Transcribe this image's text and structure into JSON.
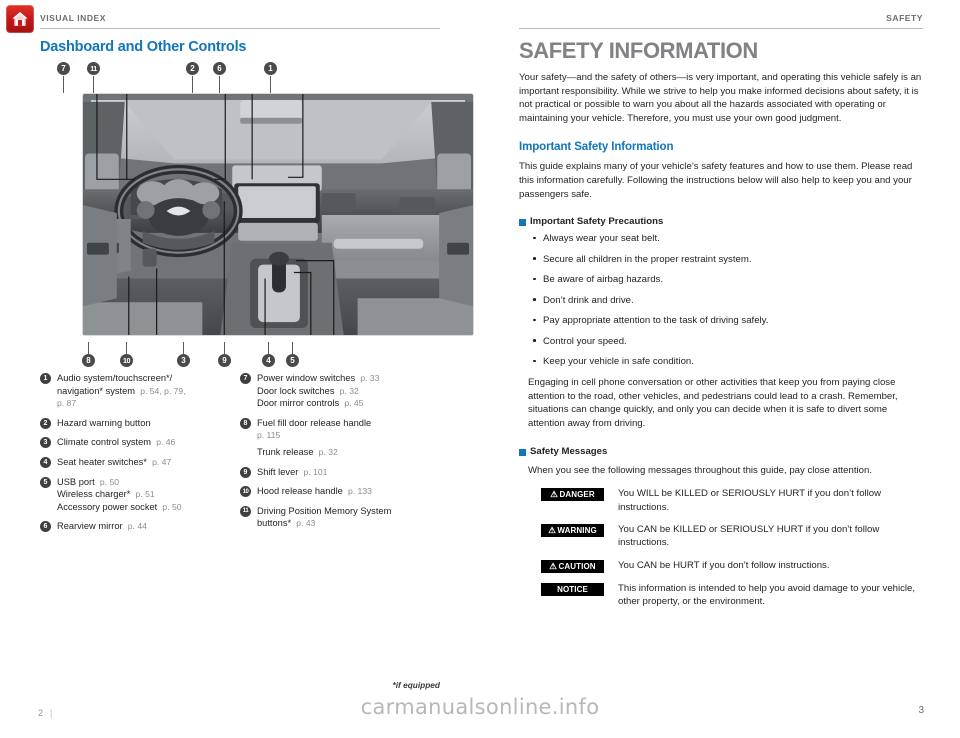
{
  "home_icon": "home-icon",
  "left_page": {
    "running_head": "VISUAL INDEX",
    "section_title": "Dashboard and Other Controls",
    "photo_alt": "dashboard-photo",
    "callouts_top": [
      "7",
      "11",
      "2",
      "6",
      "1"
    ],
    "callouts_bottom": [
      "8",
      "10",
      "3",
      "9",
      "4",
      "5"
    ],
    "legend_left": [
      {
        "num": "1",
        "lines": [
          {
            "text": "Audio system/touchscreen*/",
            "page": ""
          },
          {
            "text": "navigation* system",
            "page": "p. 54, p. 79,"
          },
          {
            "text": "",
            "page": "p. 87"
          }
        ]
      },
      {
        "num": "2",
        "lines": [
          {
            "text": "Hazard warning button",
            "page": ""
          }
        ]
      },
      {
        "num": "3",
        "lines": [
          {
            "text": "Climate control system",
            "page": "p. 46"
          }
        ]
      },
      {
        "num": "4",
        "lines": [
          {
            "text": "Seat heater switches*",
            "page": "p. 47"
          }
        ]
      },
      {
        "num": "5",
        "lines": [
          {
            "text": "USB port",
            "page": "p. 50"
          },
          {
            "text": "Wireless charger*",
            "page": "p. 51"
          },
          {
            "text": "Accessory power socket",
            "page": "p. 50"
          }
        ]
      },
      {
        "num": "6",
        "lines": [
          {
            "text": "Rearview mirror",
            "page": "p. 44"
          }
        ]
      }
    ],
    "legend_right": [
      {
        "num": "7",
        "lines": [
          {
            "text": "Power window switches",
            "page": "p. 33"
          },
          {
            "text": "Door lock switches",
            "page": "p. 32"
          },
          {
            "text": "Door mirror controls",
            "page": "p. 45"
          }
        ]
      },
      {
        "num": "8",
        "lines": [
          {
            "text": "Fuel fill door release handle",
            "page": ""
          },
          {
            "text": "",
            "page": "p. 115"
          },
          {
            "text": "Trunk release",
            "page": "p. 32"
          }
        ]
      },
      {
        "num": "9",
        "lines": [
          {
            "text": "Shift lever",
            "page": "p. 101"
          }
        ]
      },
      {
        "num": "10",
        "lines": [
          {
            "text": "Hood release handle",
            "page": "p. 133"
          }
        ]
      },
      {
        "num": "11",
        "lines": [
          {
            "text": "Driving Position Memory System",
            "page": ""
          },
          {
            "text": "buttons*",
            "page": "p. 43"
          }
        ]
      }
    ],
    "footnote": "*if equipped",
    "folio": "2"
  },
  "right_page": {
    "running_head": "SAFETY",
    "chapter_title": "SAFETY INFORMATION",
    "intro": "Your safety—and the safety of others—is very important, and operating this vehicle safely is an important responsibility. While we strive to help you make informed decisions about safety, it is not practical or possible to warn you about all the hazards associated with operating or maintaining your vehicle. Therefore, you must use your own good judgment.",
    "section_heading": "Important Safety Information",
    "section_body": "This guide explains many of your vehicle’s safety features and how to use them. Please read this information carefully. Following the instructions below will also help to keep you and your passengers safe.",
    "precautions_heading": "Important Safety Precautions",
    "precautions": [
      "Always wear your seat belt.",
      "Secure all children in the proper restraint system.",
      "Be aware of airbag hazards.",
      "Don’t drink and drive.",
      "Pay appropriate attention to the task of driving safely.",
      "Control your speed.",
      "Keep your vehicle in safe condition."
    ],
    "cellphone_para": "Engaging in cell phone conversation or other activities that keep you from paying close attention to the road, other vehicles, and pedestrians could lead to a crash. Remember, situations can change quickly, and only you can decide when it is safe to divert some attention away from driving.",
    "messages_heading": "Safety Messages",
    "messages_intro": "When you see the following messages throughout this guide, pay close attention.",
    "messages": [
      {
        "badge": "DANGER",
        "warn_symbol": "⚠",
        "has_symbol": true,
        "text": "You WILL be KILLED or SERIOUSLY HURT if you don’t follow instructions."
      },
      {
        "badge": "WARNING",
        "warn_symbol": "⚠",
        "has_symbol": true,
        "text": "You CAN be KILLED or SERIOUSLY HURT if you don’t follow instructions."
      },
      {
        "badge": "CAUTION",
        "warn_symbol": "⚠",
        "has_symbol": true,
        "text": "You CAN be HURT if you don’t follow instructions."
      },
      {
        "badge": "NOTICE",
        "warn_symbol": "",
        "has_symbol": false,
        "text": "This information is intended to help you avoid damage to your vehicle, other property, or the environment."
      }
    ],
    "folio": "3"
  },
  "watermark": "carmanualsonline.info",
  "colors": {
    "accent_blue": "#1176bc",
    "home_red": "#c5191a",
    "running_head_gray": "#6d6e71",
    "chapter_gray": "#808285",
    "page_ref_gray": "#8a8c8e",
    "badge_black": "#000000"
  }
}
